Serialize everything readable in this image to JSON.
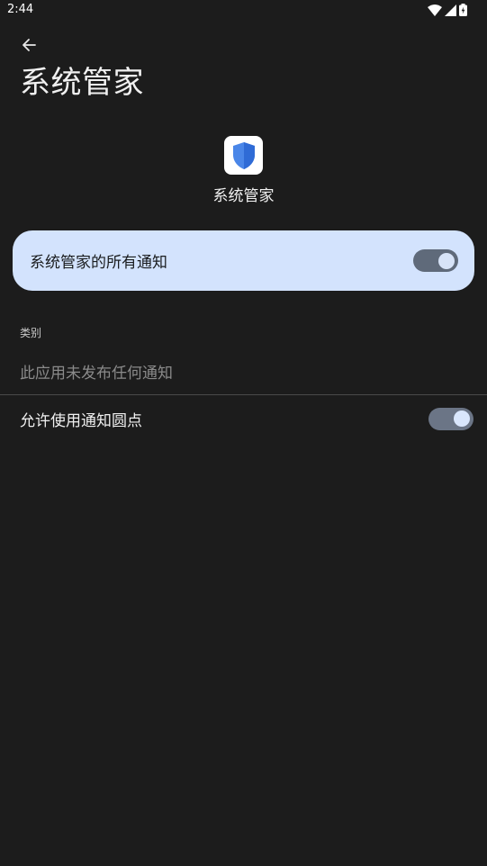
{
  "status_bar": {
    "time": "2:44",
    "icons": [
      "wifi-icon",
      "cell-signal-icon",
      "battery-charging-icon"
    ]
  },
  "header": {
    "back_icon": "arrow-left-icon",
    "title": "系统管家"
  },
  "app": {
    "icon": "shield-icon",
    "name": "系统管家"
  },
  "master_toggle": {
    "label": "系统管家的所有通知",
    "checked": true
  },
  "categories": {
    "label": "类别",
    "empty_text": "此应用未发布任何通知"
  },
  "dot_setting": {
    "label": "允许使用通知圆点",
    "checked": true
  },
  "colors": {
    "background": "#1c1c1c",
    "card": "#d3e3fd",
    "switch_track": "#5f6a7a",
    "switch_thumb": "#d7e3f7",
    "shield_blue": "#4a86e8"
  }
}
